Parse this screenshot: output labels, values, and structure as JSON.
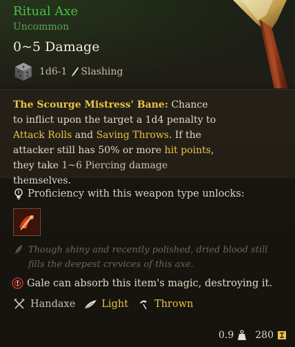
{
  "item": {
    "name": "Ritual Axe",
    "rarity": "Uncommon",
    "damage": "0~5 Damage",
    "dice": "1d6-1",
    "damage_type": "Slashing"
  },
  "description": {
    "bane_name": "The Scourge Mistress' Bane:",
    "text1": " Chance to inflict upon the target a 1d4 penalty to ",
    "attack_rolls": "Attack Rolls",
    "and": " and ",
    "saving_throws": "Saving Throws",
    "text2": ". If the attacker still has 50% or more ",
    "hit_points": "hit points",
    "text3": ", they take ",
    "piercing": "1~6 Piercing damage",
    "text4": " themselves."
  },
  "proficiency": {
    "label": "Proficiency with this weapon type unlocks:",
    "action_icon": "cleave-action-icon"
  },
  "flavor": "Though shiny and recently polished, dried blood still fills the deepest crevices of this axe.",
  "absorb": "Gale can absorb this item's magic, destroying it.",
  "properties": [
    {
      "label": "Handaxe",
      "icon": "crossed-axes-icon"
    },
    {
      "label": "Light",
      "icon": "feather-icon"
    },
    {
      "label": "Thrown",
      "icon": "thrown-icon"
    }
  ],
  "footer": {
    "weight": "0.9",
    "value": "280"
  },
  "colors": {
    "title": "#43c243",
    "rarity": "#57a653",
    "keyword": "#e8c44a"
  }
}
